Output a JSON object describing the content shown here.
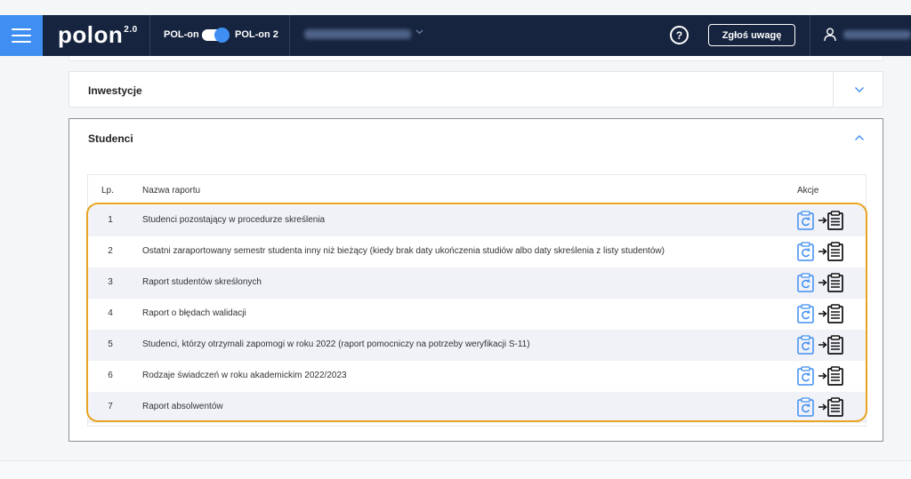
{
  "header": {
    "logo": "polon",
    "logo_version": "2.0",
    "pol_on_left": "POL-on",
    "pol_on_right": "POL-on 2",
    "help": "?",
    "report_button": "Zgłoś uwagę",
    "colors": {
      "bar": "#16243f",
      "accent": "#3f8ef2"
    }
  },
  "sections": {
    "investments": {
      "title": "Inwestycje"
    },
    "students": {
      "title": "Studenci"
    }
  },
  "table": {
    "headers": {
      "number": "Lp.",
      "name": "Nazwa raportu",
      "actions": "Akcje"
    },
    "rows": [
      {
        "num": "1",
        "name": "Studenci pozostający w procedurze skreślenia"
      },
      {
        "num": "2",
        "name": "Ostatni zaraportowany semestr studenta inny niż bieżący (kiedy brak daty ukończenia studiów albo daty skreślenia z listy studentów)"
      },
      {
        "num": "3",
        "name": "Raport studentów skreślonych"
      },
      {
        "num": "4",
        "name": "Raport o błędach walidacji"
      },
      {
        "num": "5",
        "name": "Studenci, którzy otrzymali zapomogi w roku 2022 (raport pomocniczy na potrzeby weryfikacji S-11)"
      },
      {
        "num": "6",
        "name": "Rodzaje świadczeń w roku akademickim 2022/2023"
      },
      {
        "num": "7",
        "name": "Raport absolwentów"
      }
    ],
    "action_icons": [
      "refresh-report-icon",
      "export-report-icon"
    ],
    "highlight_color": "#e9a420"
  }
}
